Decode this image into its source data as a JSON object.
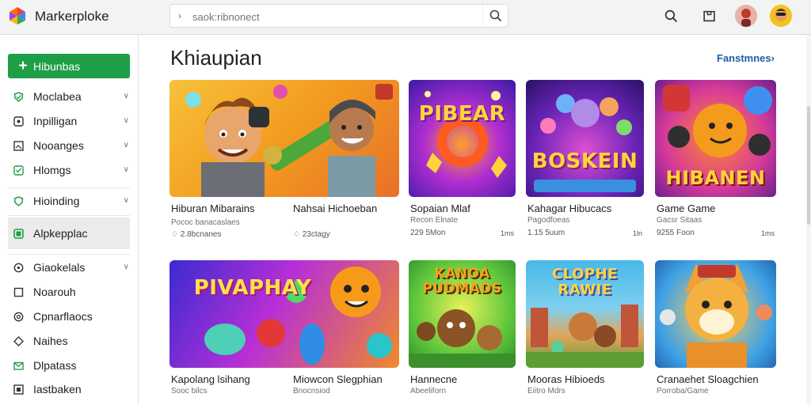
{
  "app": {
    "title": "Markerploke"
  },
  "search": {
    "placeholder": "saok:ribnonect"
  },
  "sidebar": {
    "new_button": "Hibunbas",
    "items": [
      {
        "label": "Moclabea",
        "icon": "shield-icon"
      },
      {
        "label": "Inpilligan",
        "icon": "square-icon"
      },
      {
        "label": "Nooanges",
        "icon": "image-icon"
      },
      {
        "label": "Hlomgs",
        "icon": "check-icon"
      },
      {
        "label": "Hioinding",
        "icon": "shield-icon"
      },
      {
        "label": "Alpkepplac",
        "icon": "check-square-icon",
        "active": true
      },
      {
        "label": "Giaokelals",
        "icon": "circle-icon"
      },
      {
        "label": "Noarouh",
        "icon": "square-icon"
      },
      {
        "label": "Cpnarflaocs",
        "icon": "circle-icon"
      },
      {
        "label": "Naihes",
        "icon": "diamond-icon"
      },
      {
        "label": "Dlpatass",
        "icon": "mail-icon"
      },
      {
        "label": "Iastbaken",
        "icon": "image-icon"
      }
    ]
  },
  "main": {
    "section_title": "Khiaupian",
    "see_more": "Fanstmnes",
    "cards": [
      {
        "title": "Hiburan Mibarains",
        "sub": "Pococ banacaslaes",
        "meta": "2.8bcnanes",
        "price": "",
        "art": ""
      },
      {
        "title": "Nahsai Hichoeban",
        "sub": "",
        "meta": "23ctagy",
        "price": "",
        "art": ""
      },
      {
        "title": "Sopaian Mlaf",
        "sub": "Recon Elnate",
        "meta": "229 5Mon",
        "price": "1ms",
        "art": "PIBEAR"
      },
      {
        "title": "Kahagar Hibucacs",
        "sub": "Pagodfoeas",
        "meta": "1.15 5uum",
        "price": "1ln",
        "art": "BOSKEIN"
      },
      {
        "title": "Game Game",
        "sub": "Gacsr Sitaas",
        "meta": "9255 Foon",
        "price": "1ms",
        "art": "HIBANEN"
      },
      {
        "title": "Kapolang lsihang",
        "sub": "Sooc bilcs",
        "meta": "",
        "price": "",
        "art": "PIVAPHAY"
      },
      {
        "title": "Miowcon Slegphian",
        "sub": "Bnocnsiod",
        "meta": "",
        "price": "",
        "art": ""
      },
      {
        "title": "Hannecne",
        "sub": "Abeeliforn",
        "meta": "",
        "price": "",
        "art": "KANOA PUDMADS"
      },
      {
        "title": "Mooras Hibioeds",
        "sub": "Eiitro Mdrs",
        "meta": "",
        "price": "",
        "art": "CLOPHE RAWIE"
      },
      {
        "title": "Cranaehet Sloagchien",
        "sub": "Porroba/Game",
        "meta": "",
        "price": "",
        "art": ""
      }
    ]
  },
  "colors": {
    "accent": "#1e9e47",
    "link": "#1a5fa8"
  }
}
